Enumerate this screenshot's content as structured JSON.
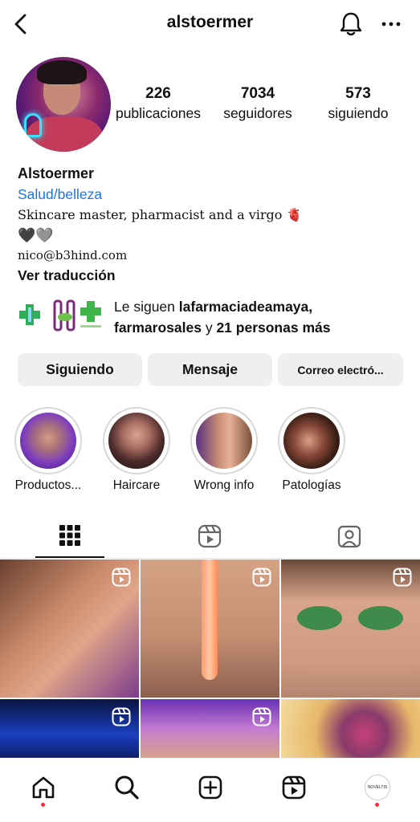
{
  "header": {
    "username": "alstoermer",
    "icons": {
      "back": "chevron-left-icon",
      "notifications": "bell-icon",
      "more": "more-horizontal-icon"
    }
  },
  "stats": {
    "posts": {
      "value": "226",
      "label": "publicaciones"
    },
    "followers": {
      "value": "7034",
      "label": "seguidores"
    },
    "following": {
      "value": "573",
      "label": "siguiendo"
    }
  },
  "bio": {
    "name": "Alstoermer",
    "category": "Salud/belleza",
    "text": "Skincare master, pharmacist and a virgo",
    "text_emoji": "🫀",
    "hearts": "🖤🩶",
    "email": "nico@b3hind.com",
    "translate_label": "Ver traducción"
  },
  "followed_by": {
    "prefix": "Le siguen ",
    "account1": "lafarmaciadeamaya",
    "separator": ",",
    "account2": "farmarosales",
    "conjunction": " y ",
    "others": "21 personas más"
  },
  "actions": {
    "following_label": "Siguiendo",
    "message_label": "Mensaje",
    "email_label": "Correo electró..."
  },
  "highlights": [
    {
      "label": "Productos..."
    },
    {
      "label": "Haircare"
    },
    {
      "label": "Wrong info"
    },
    {
      "label": "Patologías"
    }
  ],
  "tabs": {
    "icons": [
      "grid-icon",
      "reels-icon",
      "tagged-icon"
    ],
    "active": "grid"
  },
  "nav": {
    "icons": [
      "home-icon",
      "search-icon",
      "create-icon",
      "reels-icon",
      "profile-avatar"
    ],
    "profile_mini_text": "NOVELTIS"
  },
  "colors": {
    "link_blue": "#1877e8",
    "button_bg": "#efeff1",
    "notification_dot": "#ff2d3c"
  }
}
